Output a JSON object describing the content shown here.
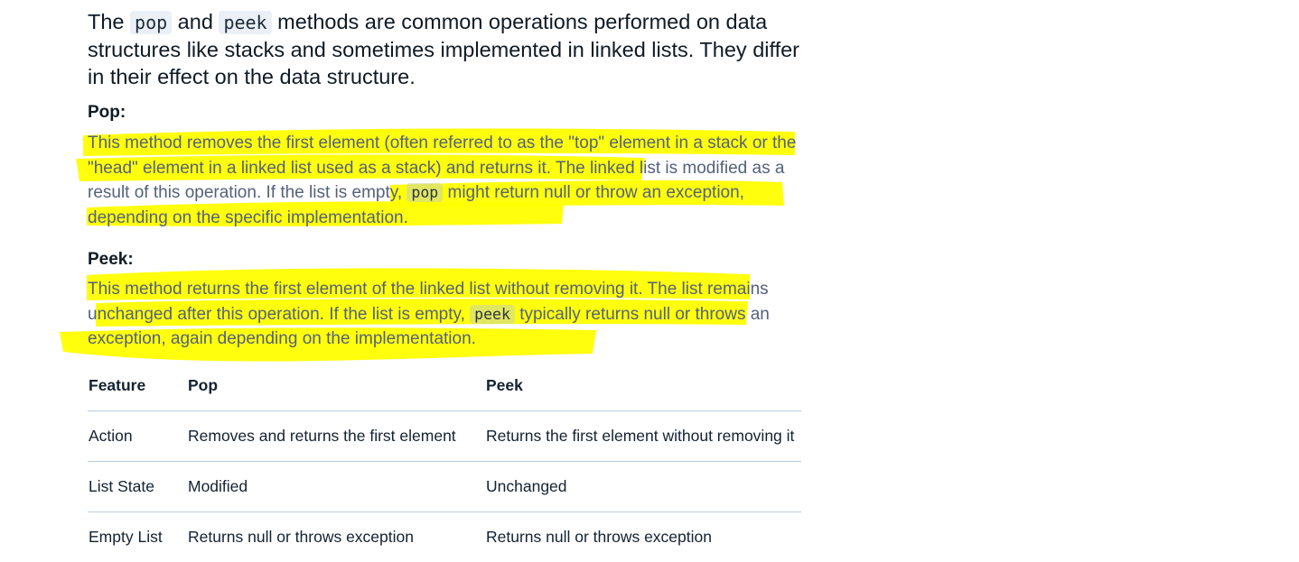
{
  "intro": {
    "part1": "The ",
    "code1": "pop",
    "part2": " and ",
    "code2": "peek",
    "part3": " methods are common operations performed on data structures like stacks and sometimes implemented in linked lists. They differ in their effect on the data structure."
  },
  "pop_section": {
    "heading": "Pop:",
    "text1": "This method removes the first element (often referred to as the \"top\" element in a stack or the \"head\" element in a linked list used as a stack) and returns it. The linked list is modified as a result of this operation. If the list is empty, ",
    "code": "pop",
    "text2": " might return null or throw an exception, depending on the specific implementation."
  },
  "peek_section": {
    "heading": "Peek:",
    "text1": "This method returns the first element of the linked list without removing it. The list remains unchanged after this operation. If the list is empty, ",
    "code": "peek",
    "text2": " typically returns null or throws an exception, again depending on the implementation."
  },
  "table": {
    "headers": [
      "Feature",
      "Pop",
      "Peek"
    ],
    "rows": [
      [
        "Action",
        "Removes and returns the first element",
        "Returns the first element without removing it"
      ],
      [
        "List State",
        "Modified",
        "Unchanged"
      ],
      [
        "Empty List",
        "Returns null or throws exception",
        "Returns null or throws exception"
      ]
    ]
  },
  "colors": {
    "highlight": "#ffff00",
    "text": "#55617a",
    "heading": "#0f1a24",
    "divider": "#b9ccd8"
  }
}
